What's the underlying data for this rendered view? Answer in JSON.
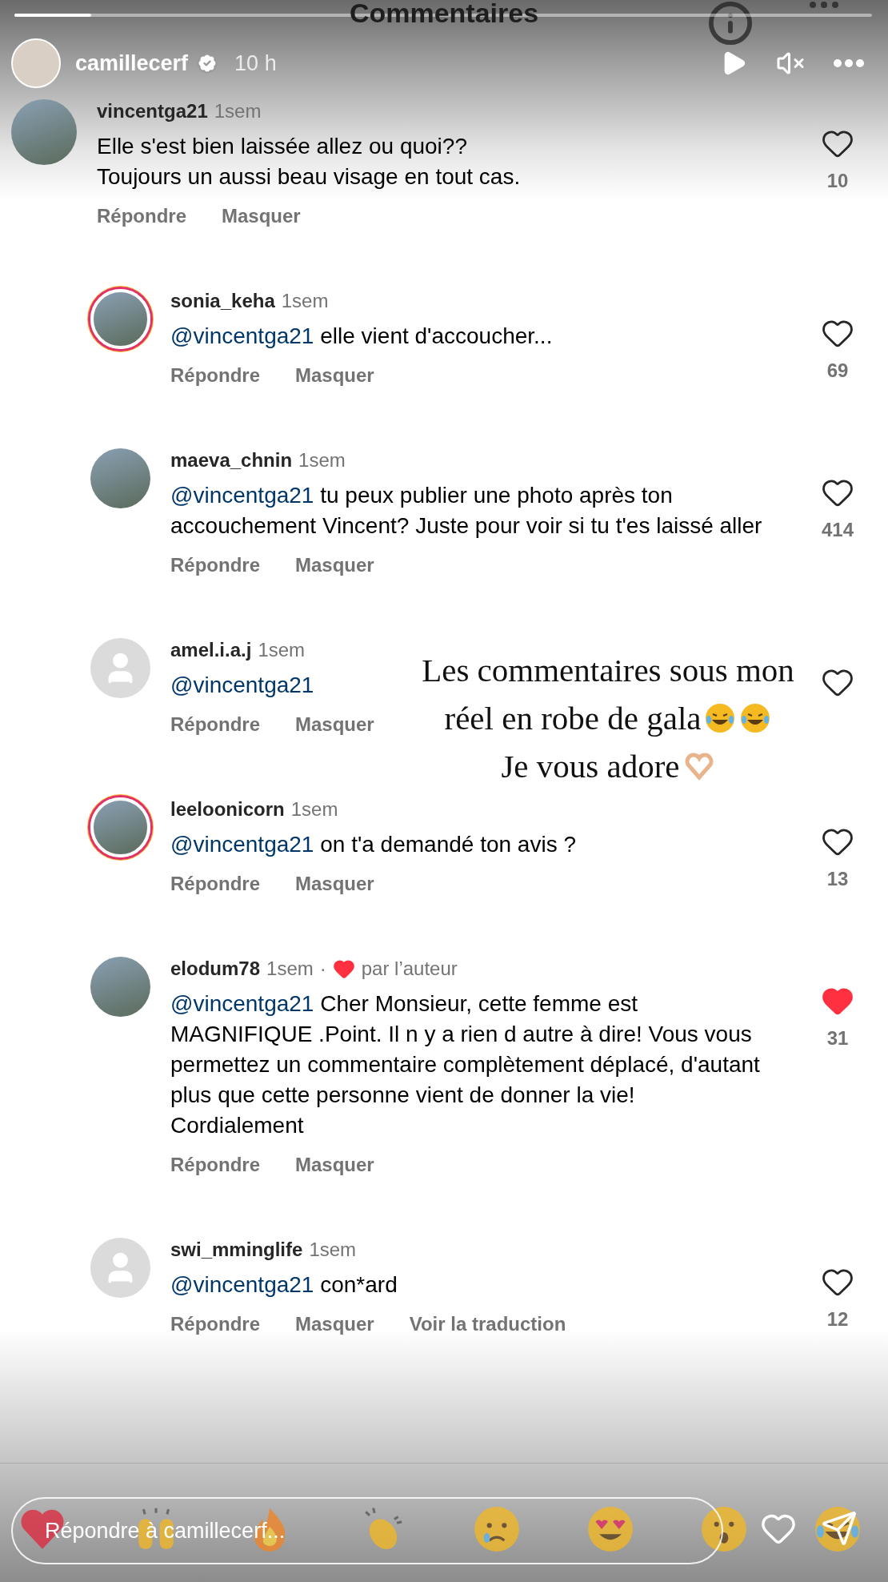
{
  "progress": {
    "level": 0.09
  },
  "sheet_title": "Commentaires",
  "story": {
    "username": "camillecerf",
    "verified": true,
    "time": "10 h"
  },
  "comments": [
    {
      "username": "vincentga21",
      "time": "1sem",
      "avatar": {
        "kind": "photo"
      },
      "story_ring": false,
      "reply": false,
      "text": "Elle s'est bien laissée allez ou quoi??\nToujours un aussi beau visage en tout cas.",
      "liked": false,
      "count": "10",
      "actions": [
        "Répondre",
        "Masquer"
      ]
    },
    {
      "username": "sonia_keha",
      "time": "1sem",
      "avatar": {
        "kind": "photo"
      },
      "story_ring": true,
      "reply": true,
      "mention": "@vincentga21",
      "text": "elle vient d'accoucher...",
      "liked": false,
      "count": "69",
      "actions": [
        "Répondre",
        "Masquer"
      ]
    },
    {
      "username": "maeva_chnin",
      "time": "1sem",
      "avatar": {
        "kind": "photo"
      },
      "story_ring": false,
      "reply": true,
      "mention": "@vincentga21",
      "text": "tu peux publier une photo après ton accouchement Vincent? Juste pour voir si tu t'es laissé aller",
      "liked": false,
      "count": "414",
      "actions": [
        "Répondre",
        "Masquer"
      ]
    },
    {
      "username": "amel.i.a.j",
      "time": "1sem",
      "avatar": {
        "kind": "default"
      },
      "story_ring": false,
      "reply": true,
      "mention": "@vincentga21",
      "liked": false,
      "actions": [
        "Répondre",
        "Masquer"
      ]
    },
    {
      "username": "leeloonicorn",
      "time": "1sem",
      "avatar": {
        "kind": "photo"
      },
      "story_ring": true,
      "reply": true,
      "mention": "@vincentga21",
      "text": "on t'a demandé ton avis ?",
      "liked": false,
      "count": "13",
      "actions": [
        "Répondre",
        "Masquer"
      ]
    },
    {
      "username": "elodum78",
      "time": "1sem",
      "author_like": {
        "separator": "·",
        "label": "par l’auteur"
      },
      "avatar": {
        "kind": "photo"
      },
      "story_ring": false,
      "reply": true,
      "mention": "@vincentga21",
      "text": "Cher Monsieur, cette femme est MAGNIFIQUE .Point. Il n y a rien d autre à dire! Vous vous permettez un commentaire complètement déplacé, d'autant plus que cette personne vient de donner la vie! Cordialement",
      "liked": true,
      "count": "31",
      "actions": [
        "Répondre",
        "Masquer"
      ]
    },
    {
      "username": "swi_mminglife",
      "time": "1sem",
      "avatar": {
        "kind": "default"
      },
      "story_ring": false,
      "reply": true,
      "mention": "@vincentga21",
      "text": "con*ard",
      "liked": false,
      "count": "12",
      "actions": [
        "Répondre",
        "Masquer",
        "Voir la traduction"
      ]
    }
  ],
  "caption": [
    {
      "text": "Les commentaires sous mon"
    },
    {
      "text": "réel en robe de gala",
      "emojis": [
        {
          "kind": "laughing"
        },
        {
          "kind": "laughing"
        }
      ]
    },
    {
      "text": "Je vous adore",
      "emojis": [
        {
          "kind": "heart_hands"
        }
      ]
    }
  ],
  "reply_bar": {
    "placeholder": "Répondre à camillecerf...",
    "reactions": [
      {
        "kind": "heart"
      },
      {
        "kind": "raised_hands"
      },
      {
        "kind": "fire"
      },
      {
        "kind": "clap"
      },
      {
        "kind": "crying"
      },
      {
        "kind": "heart_eyes"
      },
      {
        "kind": "surprised"
      },
      {
        "kind": "laughing"
      }
    ]
  }
}
